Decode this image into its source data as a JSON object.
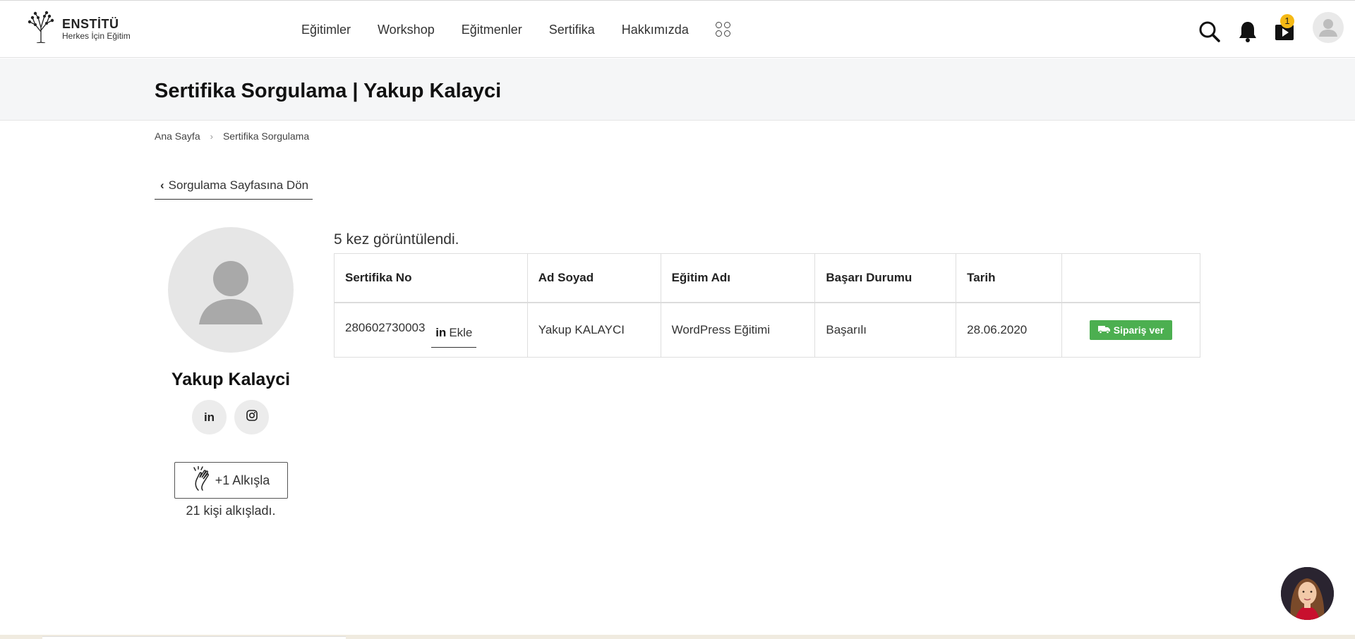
{
  "brand": {
    "name": "ENSTİTÜ",
    "tagline": "Herkes İçin Eğitim"
  },
  "nav": {
    "items": [
      "Eğitimler",
      "Workshop",
      "Eğitmenler",
      "Sertifika",
      "Hakkımızda"
    ]
  },
  "header": {
    "cart_count": "1"
  },
  "page": {
    "title": "Sertifika Sorgulama | Yakup Kalayci"
  },
  "breadcrumb": {
    "home": "Ana Sayfa",
    "current": "Sertifika Sorgulama"
  },
  "back_button": {
    "label": "Sorgulama Sayfasına Dön"
  },
  "profile": {
    "name": "Yakup Kalayci",
    "applaud_label": "+1 Alkışla",
    "applaud_count_text": "21 kişi alkışladı."
  },
  "certificate": {
    "views_text": "5 kez görüntülendi.",
    "columns": [
      "Sertifika No",
      "Ad Soyad",
      "Eğitim Adı",
      "Başarı Durumu",
      "Tarih",
      ""
    ],
    "row": {
      "cert_no": "280602730003",
      "linkedin_add": "Ekle",
      "full_name": "Yakup KALAYCI",
      "course": "WordPress Eğitimi",
      "status": "Başarılı",
      "date": "28.06.2020",
      "order_label": "Sipariş ver"
    }
  },
  "colors": {
    "order_button": "#4caf50",
    "badge": "#f5b915"
  },
  "icons": [
    "tree-logo-icon",
    "apps-grid-icon",
    "search-icon",
    "bell-icon",
    "video-cart-icon",
    "user-avatar-icon",
    "chevron-left-icon",
    "linkedin-icon",
    "instagram-icon",
    "clap-icon",
    "truck-icon"
  ]
}
